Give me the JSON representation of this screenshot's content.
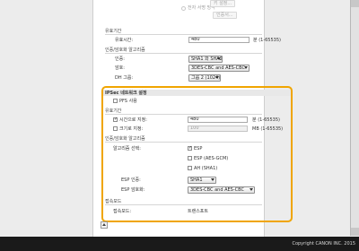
{
  "top_options": {
    "radio_label": "전자 서명 방식",
    "key_button": "키 설정...",
    "cert_button": "인증서..."
  },
  "ike": {
    "validity_heading": "유효기간",
    "lifetime_label": "유효시간:",
    "lifetime_value": "480",
    "lifetime_unit": "분 (1-65535)",
    "algo_heading": "인증/암호화 알고리즘",
    "auth_label": "인증:",
    "auth_value": "SHA1 와 SHA2",
    "encryption_label": "암호:",
    "encryption_value": "3DES-CBC and AES-CBC",
    "dh_label": "DH 그룹:",
    "dh_value": "그룹 2 (1024)"
  },
  "ipsec": {
    "section_title": "IPSec 네트워크 설정",
    "pfs_label": "PFS 사용",
    "pfs_checked": false,
    "validity_heading": "유효기간",
    "time_label": "시간으로 지정:",
    "time_checked": true,
    "time_value": "480",
    "time_unit": "분 (1-65535)",
    "size_label": "크기로 지정:",
    "size_checked": false,
    "size_value": "100",
    "size_unit": "MB (1-65535)",
    "algo_heading": "인증/암호화 알고리즘",
    "algo_select_label": "알고리즘 선택:",
    "esp_label": "ESP",
    "esp_checked": true,
    "esp_gcm_label": "ESP (AES-GCM)",
    "esp_gcm_checked": false,
    "ah_label": "AH (SHA1)",
    "ah_checked": false,
    "esp_auth_label": "ESP 인증:",
    "esp_auth_value": "SHA1",
    "esp_enc_label": "ESP 암호화:",
    "esp_enc_value": "3DES-CBC and AES-CBC",
    "connection_heading": "접속모드",
    "connection_label": "접속모드:",
    "connection_value": "트랜스포트"
  },
  "footer": {
    "copyright": "Copyright CANON INC. 2015"
  },
  "colors": {
    "highlight": "#f0a500",
    "footer_bg": "#1a1a1a"
  },
  "icons": {
    "scroll_top": "up-arrow-icon",
    "checkmark": "checkmark-icon"
  }
}
